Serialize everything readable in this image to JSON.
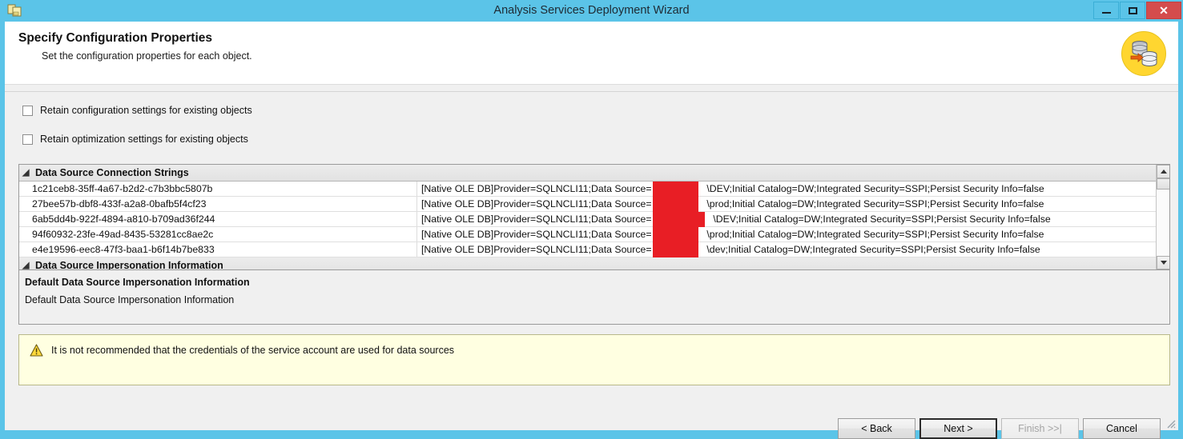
{
  "window": {
    "title": "Analysis Services Deployment Wizard",
    "icon": "wizard-package-icon",
    "controls": {
      "minimize": "minimize-icon",
      "maximize": "maximize-icon",
      "close": "✕"
    },
    "accent_color": "#5bc4e8",
    "close_color": "#d44c4c"
  },
  "header": {
    "title": "Specify Configuration Properties",
    "subtitle": "Set the configuration properties for each object.",
    "logo": "database-deploy-icon",
    "logo_bg": "#ffd630"
  },
  "options": [
    {
      "label": "Retain configuration settings for existing objects",
      "checked": false
    },
    {
      "label": "Retain optimization settings for existing objects",
      "checked": false
    }
  ],
  "grid": {
    "categories": [
      {
        "label": "Data Source Connection Strings",
        "expanded": true
      },
      {
        "label": "Data Source Impersonation Information",
        "expanded": true
      }
    ],
    "rows": [
      {
        "name": "1c21ceb8-35ff-4a67-b2d2-c7b3bbc5807b",
        "value_prefix": "[Native OLE DB]Provider=SQLNCLI11;Data Source=",
        "value_suffix": "\\DEV;Initial Catalog=DW;Integrated Security=SSPI;Persist Security Info=false",
        "redacted": true
      },
      {
        "name": "27bee57b-dbf8-433f-a2a8-0bafb5f4cf23",
        "value_prefix": "[Native OLE DB]Provider=SQLNCLI11;Data Source=",
        "value_suffix": "\\prod;Initial Catalog=DW;Integrated Security=SSPI;Persist Security Info=false",
        "redacted": true
      },
      {
        "name": "6ab5dd4b-922f-4894-a810-b709ad36f244",
        "value_prefix": "[Native OLE DB]Provider=SQLNCLI11;Data Source=",
        "value_suffix": "\\DEV;Initial Catalog=DW;Integrated Security=SSPI;Persist Security Info=false",
        "redacted": true
      },
      {
        "name": "94f60932-23fe-49ad-8435-53281cc8ae2c",
        "value_prefix": "[Native OLE DB]Provider=SQLNCLI11;Data Source=",
        "value_suffix": "\\prod;Initial Catalog=DW;Integrated Security=SSPI;Persist Security Info=false",
        "redacted": true
      },
      {
        "name": "e4e19596-eec8-47f3-baa1-b6f14b7be833",
        "value_prefix": "[Native OLE DB]Provider=SQLNCLI11;Data Source=",
        "value_suffix": "\\dev;Initial Catalog=DW;Integrated Security=SSPI;Persist Security Info=false",
        "redacted": true
      }
    ],
    "redaction_color": "#e81e25",
    "scrollbar": {
      "up": "scroll-up-arrow",
      "down": "scroll-down-arrow"
    }
  },
  "description": {
    "title": "Default Data Source Impersonation Information",
    "body": "Default Data Source Impersonation Information"
  },
  "warning": {
    "icon": "warning-triangle-icon",
    "text": "It is not recommended that the credentials of the service account are used for data sources",
    "background": "#ffffe1"
  },
  "buttons": {
    "back": "< Back",
    "next": "Next >",
    "finish": "Finish >>|",
    "cancel": "Cancel"
  }
}
